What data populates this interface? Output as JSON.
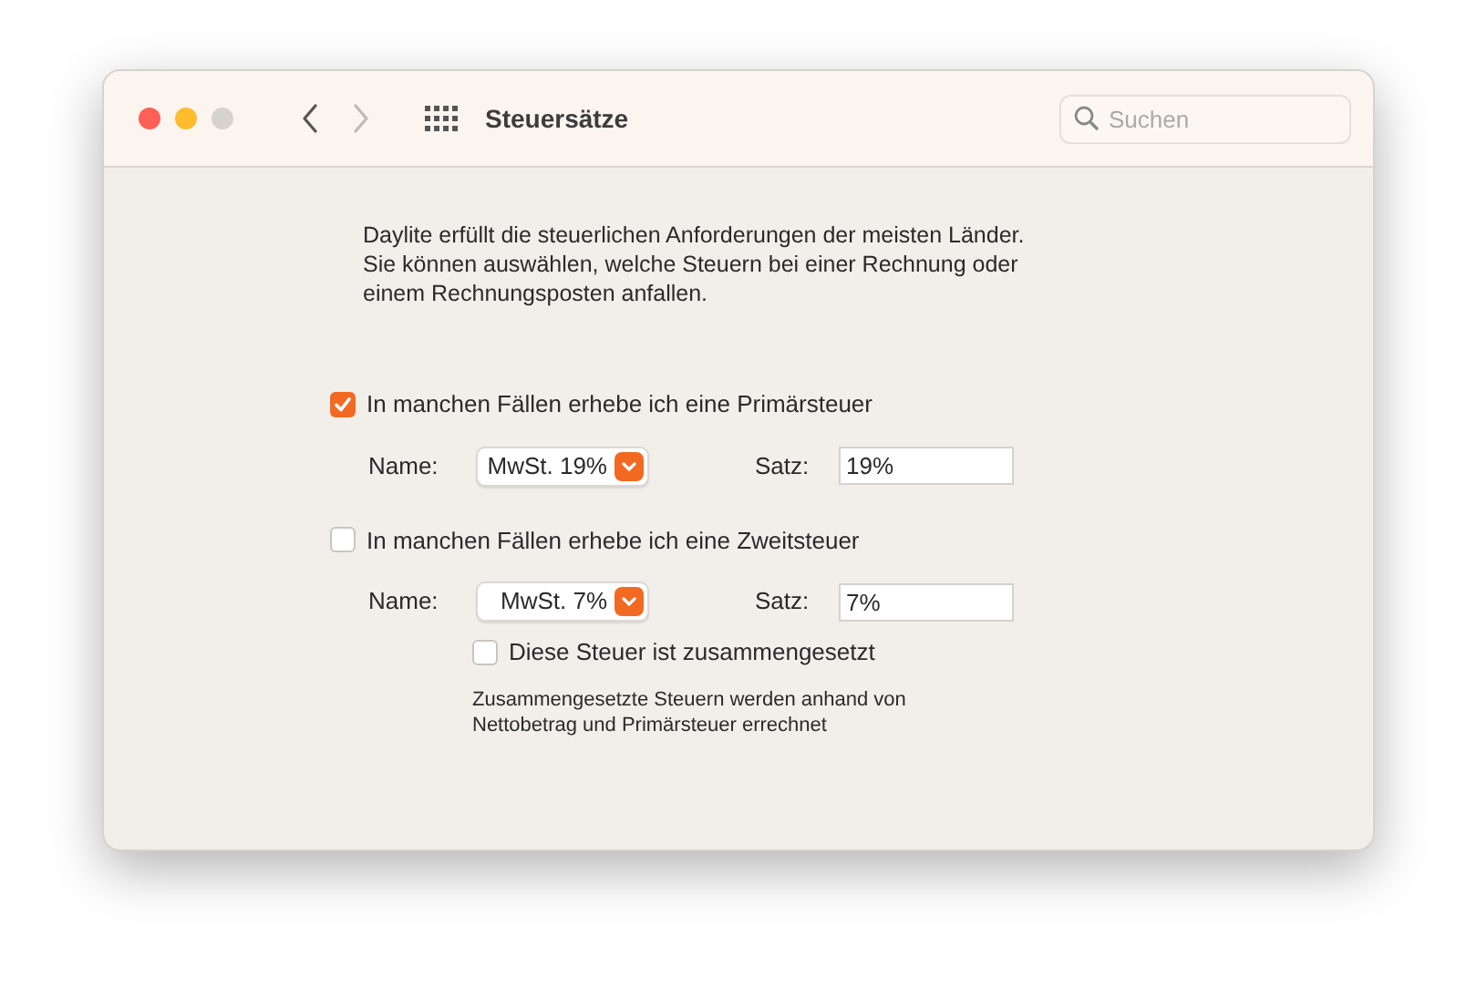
{
  "window": {
    "title": "Steuersätze",
    "search": {
      "placeholder": "Suchen"
    },
    "nav_buttons": [
      {
        "kind": "back",
        "disabled": false
      },
      {
        "kind": "forward",
        "disabled": true
      }
    ]
  },
  "description": "Daylite erfüllt die steuerlichen Anforderungen der meisten Länder. Sie können auswählen, welche Steuern bei einer Rechnung oder einem Rechnungsposten anfallen.",
  "taxes": [
    {
      "label": "In manchen Fällen erhebe ich eine Primärsteuer",
      "checked": true,
      "name_label": "Name:",
      "name_value": "MwSt. 19%",
      "rate_label": "Satz:",
      "rate_value": "19%"
    },
    {
      "label": "In manchen Fällen erhebe ich eine Zweitsteuer",
      "checked": false,
      "name_label": "Name:",
      "name_value": "MwSt. 7%",
      "rate_label": "Satz:",
      "rate_value": "7%"
    }
  ],
  "compound": {
    "label": "Diese Steuer ist zusammengesetzt",
    "checked": false,
    "note": "Zusammengesetzte Steuern werden anhand von Nettobetrag und Primärsteuer errechnet"
  }
}
